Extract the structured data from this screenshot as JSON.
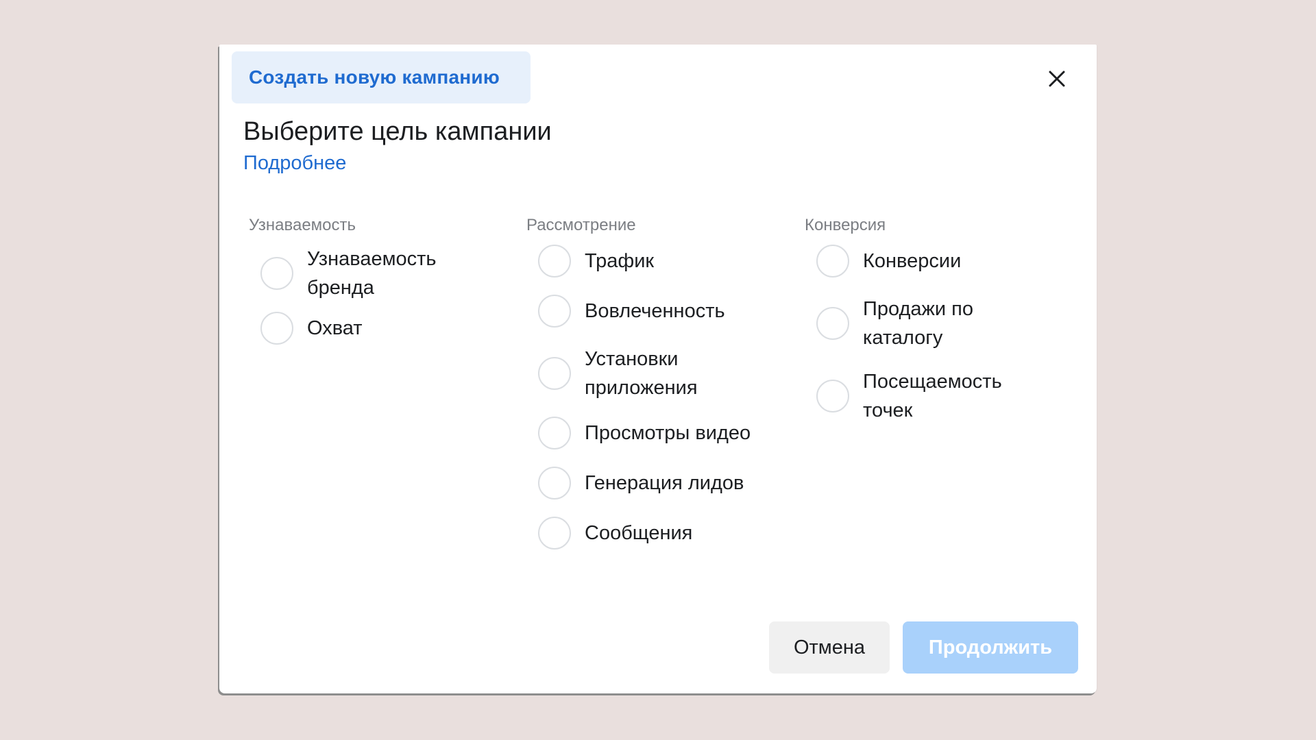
{
  "dialog": {
    "tab_title": "Создать новую кампанию",
    "heading": "Выберите цель кампании",
    "learn_more": "Подробнее",
    "close_icon": "close-icon"
  },
  "columns": [
    {
      "heading": "Узнаваемость",
      "options": [
        "Узнаваемость бренда",
        "Охват"
      ]
    },
    {
      "heading": "Рассмотрение",
      "options": [
        "Трафик",
        "Вовлеченность",
        "Установки приложения",
        "Просмотры видео",
        "Генерация лидов",
        "Сообщения"
      ]
    },
    {
      "heading": "Конверсия",
      "options": [
        "Конверсии",
        "Продажи по каталогу",
        "Посещаемость точек"
      ]
    }
  ],
  "footer": {
    "cancel_label": "Отмена",
    "continue_label": "Продолжить",
    "continue_disabled": true
  },
  "colors": {
    "accent": "#1f6bd0",
    "tab_background": "#e7f0fb",
    "disabled_button": "#a9d1fb",
    "page_background": "#e9dfdd"
  }
}
